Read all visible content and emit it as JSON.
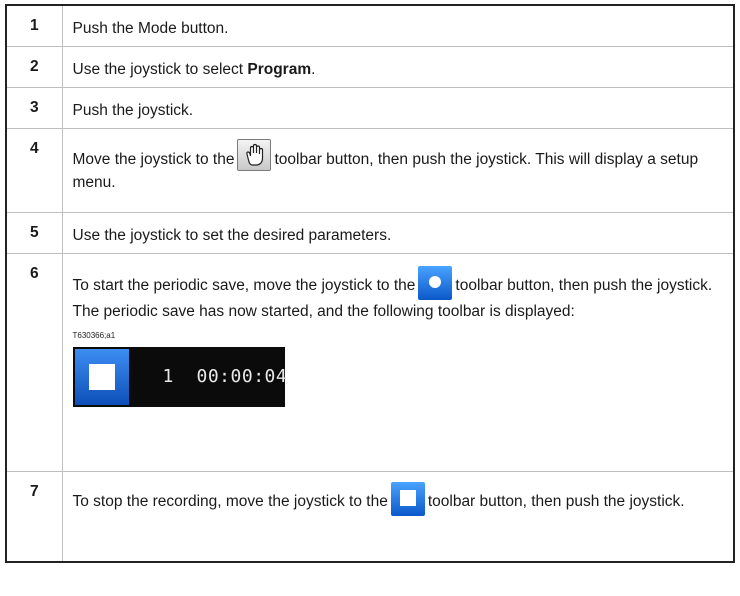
{
  "steps": [
    {
      "num": "1",
      "text": "Push the Mode button."
    },
    {
      "num": "2",
      "text_before": "Use the joystick to select ",
      "bold": "Program",
      "text_after": "."
    },
    {
      "num": "3",
      "text": "Push the joystick."
    },
    {
      "num": "4",
      "text_before": "Move the joystick to the",
      "icon": "hand-toolbar-icon",
      "text_after": "toolbar button, then push the joystick. This will display a setup menu."
    },
    {
      "num": "5",
      "text": "Use the joystick to set the desired parameters."
    },
    {
      "num": "6",
      "text_before": "To start the periodic save, move the joystick to the",
      "icon": "record-icon",
      "text_after": "toolbar button, then push the joystick. The periodic save has now started, and the following toolbar is displayed:",
      "image_id": "T630366;a1",
      "toolbar_counter": "1  00:00:04"
    },
    {
      "num": "7",
      "text_before": "To stop the recording, move the joystick to the",
      "icon": "stop-icon",
      "text_after": "toolbar button, then push the joystick."
    }
  ],
  "colors": {
    "border": "#222222",
    "grid": "#bfbfbf",
    "button_blue": "#1a6fe0",
    "toolbar_bg": "#0b0b0b"
  }
}
